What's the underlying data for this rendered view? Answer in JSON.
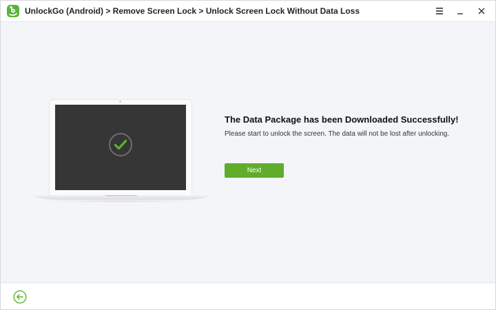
{
  "window": {
    "title": "UnlockGo (Android) > Remove Screen Lock > Unlock Screen Lock Without Data Loss",
    "controls": [
      "menu-icon",
      "minimize-icon",
      "close-icon"
    ]
  },
  "message": {
    "title": "The Data Package has been Downloaded Successfully!",
    "description": "Please start to unlock the screen. The data will not be lost after unlocking.",
    "next_label": "Next"
  },
  "footer": {
    "back_icon": "back-arrow-icon"
  },
  "colors": {
    "accent_green": "#60ad2b",
    "check_green": "#5ab52a",
    "screen_dark": "#363636"
  }
}
